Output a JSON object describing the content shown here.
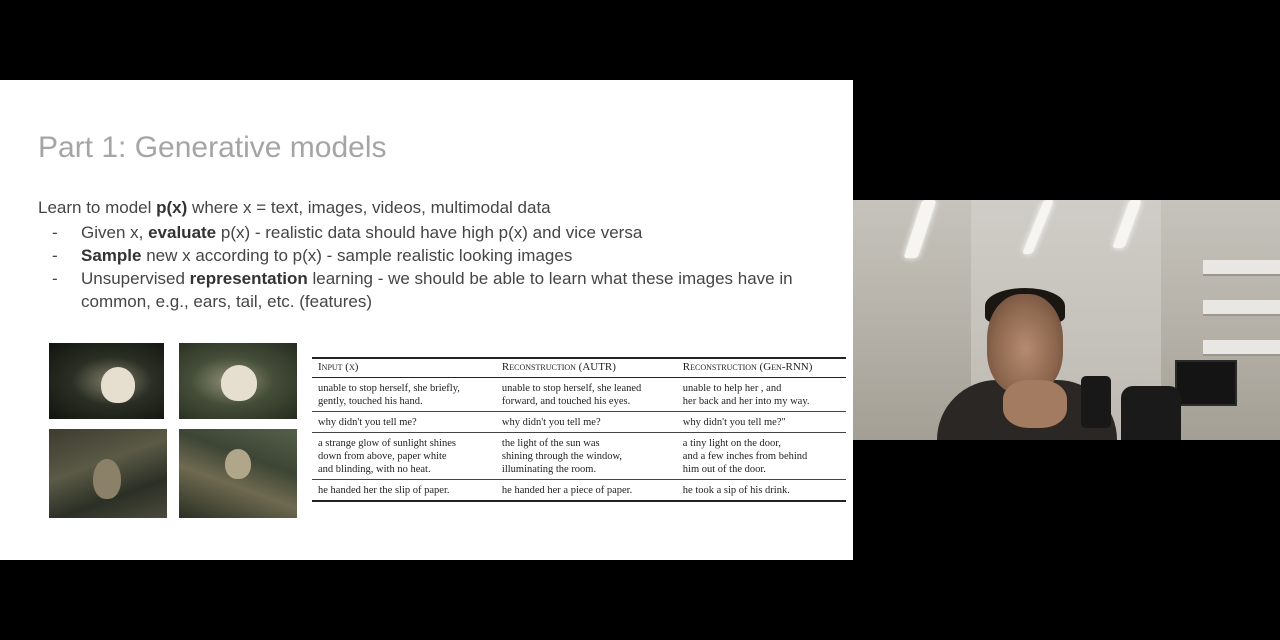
{
  "slide": {
    "title": "Part 1: Generative models",
    "intro": {
      "prefix": "Learn to model ",
      "bold": "p(x)",
      "suffix": " where x = text, images, videos, multimodal data"
    },
    "bullets": [
      {
        "dash": "-",
        "before": "Given x, ",
        "bold": "evaluate",
        "after": " p(x) - realistic data should have high p(x) and vice versa"
      },
      {
        "dash": "-",
        "before": "",
        "bold": "Sample",
        "after": " new x according to p(x) - sample realistic looking images"
      },
      {
        "dash": "-",
        "before": "Unsupervised ",
        "bold": "representation",
        "after": " learning - we should be able to learn what these images have in common, e.g., ears, tail, etc. (features)"
      }
    ],
    "table": {
      "headers": [
        "Input (x)",
        "Reconstruction (AUTR)",
        "Reconstruction (Gen-RNN)"
      ],
      "rows": [
        [
          [
            "unable to stop herself, she briefly,",
            "gently, touched his hand."
          ],
          [
            "unable to stop herself, she leaned",
            "forward, and touched his eyes."
          ],
          [
            "unable to help her , and",
            "her back and her into my way."
          ]
        ],
        [
          [
            "why didn't you tell me?"
          ],
          [
            "why didn't you tell me?"
          ],
          [
            "why didn't you tell me?\""
          ]
        ],
        [
          [
            "a strange glow of sunlight shines",
            "down from above, paper white",
            "and blinding, with no heat."
          ],
          [
            "the light of the sun was",
            "shining through the window,",
            "illuminating the room."
          ],
          [
            "a tiny light on the door,",
            "and a few inches from behind",
            "him out of the door."
          ]
        ],
        [
          [
            "he handed her the slip of paper."
          ],
          [
            "he handed her a piece of paper."
          ],
          [
            "he took a sip of his drink."
          ]
        ]
      ]
    }
  },
  "colors": {
    "background": "#000000",
    "slide_background": "#ffffff",
    "title_color": "#a5a5a5",
    "body_text": "#454545"
  }
}
